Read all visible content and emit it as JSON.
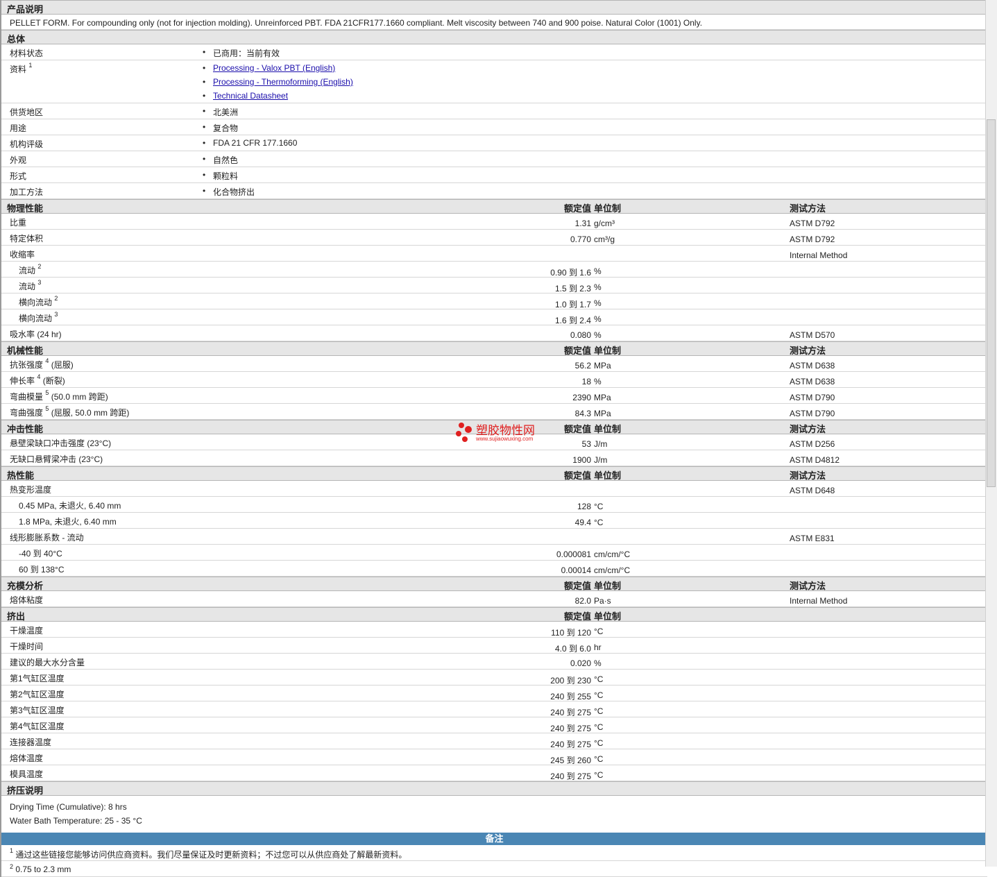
{
  "description": {
    "header": "产品说明",
    "text": "PELLET FORM. For compounding only (not for injection molding). Unreinforced PBT. FDA 21CFR177.1660 compliant. Melt viscosity between 740 and 900 poise. Natural Color (1001) Only."
  },
  "general": {
    "header": "总体",
    "status_label": "材料状态",
    "status_value": "已商用：当前有效",
    "docs_label": "资料",
    "docs_sup": "1",
    "docs": [
      "Processing - Valox PBT (English)",
      "Processing - Thermoforming (English)",
      "Technical Datasheet"
    ],
    "rows": [
      {
        "label": "供货地区",
        "value": "北美洲"
      },
      {
        "label": "用途",
        "value": "复合物"
      },
      {
        "label": "机构评级",
        "value": "FDA 21 CFR 177.1660"
      },
      {
        "label": "外观",
        "value": "自然色"
      },
      {
        "label": "形式",
        "value": "颗粒料"
      },
      {
        "label": "加工方法",
        "value": "化合物挤出"
      }
    ]
  },
  "cols": {
    "value": "额定值",
    "unit": "单位制",
    "method": "测试方法"
  },
  "physical": {
    "header": "物理性能",
    "rows": [
      {
        "label": "比重",
        "value": "1.31",
        "unit": "g/cm³",
        "method": "ASTM D792"
      },
      {
        "label": "特定体积",
        "value": "0.770",
        "unit": "cm³/g",
        "method": "ASTM D792"
      },
      {
        "label": "收缩率",
        "value": "",
        "unit": "",
        "method": "Internal Method"
      },
      {
        "label": "流动",
        "sup": "2",
        "indent": true,
        "value": "0.90 到  1.6",
        "unit": "%",
        "method": ""
      },
      {
        "label": "流动",
        "sup": "3",
        "indent": true,
        "value": "1.5 到  2.3",
        "unit": "%",
        "method": ""
      },
      {
        "label": "横向流动",
        "sup": "2",
        "indent": true,
        "value": "1.0 到  1.7",
        "unit": "%",
        "method": ""
      },
      {
        "label": "横向流动",
        "sup": "3",
        "indent": true,
        "value": "1.6 到  2.4",
        "unit": "%",
        "method": ""
      },
      {
        "label": "吸水率  (24 hr)",
        "value": "0.080",
        "unit": "%",
        "method": "ASTM D570"
      }
    ]
  },
  "mechanical": {
    "header": "机械性能",
    "rows": [
      {
        "label": "抗张强度",
        "sup": "4",
        "suffix": " (屈服)",
        "value": "56.2",
        "unit": "MPa",
        "method": "ASTM D638"
      },
      {
        "label": "伸长率",
        "sup": "4",
        "suffix": " (断裂)",
        "value": "18",
        "unit": "%",
        "method": "ASTM D638"
      },
      {
        "label": "弯曲模量",
        "sup": "5",
        "suffix": " (50.0 mm 跨距)",
        "value": "2390",
        "unit": "MPa",
        "method": "ASTM D790"
      },
      {
        "label": "弯曲强度",
        "sup": "5",
        "suffix": " (屈服, 50.0 mm 跨距)",
        "value": "84.3",
        "unit": "MPa",
        "method": "ASTM D790"
      }
    ]
  },
  "impact": {
    "header": "冲击性能",
    "rows": [
      {
        "label": "悬壁梁缺口冲击强度  (23°C)",
        "value": "53",
        "unit": "J/m",
        "method": "ASTM D256"
      },
      {
        "label": "无缺口悬臂梁冲击  (23°C)",
        "value": "1900",
        "unit": "J/m",
        "method": "ASTM D4812"
      }
    ]
  },
  "thermal": {
    "header": "热性能",
    "rows": [
      {
        "label": "热变形温度",
        "value": "",
        "unit": "",
        "method": "ASTM D648"
      },
      {
        "label": "0.45 MPa, 未退火, 6.40 mm",
        "indent": true,
        "value": "128",
        "unit": "°C",
        "method": ""
      },
      {
        "label": "1.8 MPa, 未退火, 6.40 mm",
        "indent": true,
        "value": "49.4",
        "unit": "°C",
        "method": ""
      },
      {
        "label": "线形膨胀系数  - 流动",
        "value": "",
        "unit": "",
        "method": "ASTM E831"
      },
      {
        "label": "-40 到  40°C",
        "indent": true,
        "value": "0.000081",
        "unit": "cm/cm/°C",
        "method": ""
      },
      {
        "label": "60 到  138°C",
        "indent": true,
        "value": "0.00014",
        "unit": "cm/cm/°C",
        "method": ""
      }
    ]
  },
  "filling": {
    "header": "充模分析",
    "rows": [
      {
        "label": "熔体粘度",
        "value": "82.0",
        "unit": "Pa·s",
        "method": "Internal Method"
      }
    ]
  },
  "extrusion": {
    "header": "挤出",
    "rows": [
      {
        "label": "干燥温度",
        "value": "110 到  120",
        "unit": "°C"
      },
      {
        "label": "干燥时间",
        "value": "4.0 到  6.0",
        "unit": "hr"
      },
      {
        "label": "建议的最大水分含量",
        "value": "0.020",
        "unit": "%"
      },
      {
        "label": "第1气缸区温度",
        "value": "200 到  230",
        "unit": "°C"
      },
      {
        "label": "第2气缸区温度",
        "value": "240 到  255",
        "unit": "°C"
      },
      {
        "label": "第3气缸区温度",
        "value": "240 到  275",
        "unit": "°C"
      },
      {
        "label": "第4气缸区温度",
        "value": "240 到  275",
        "unit": "°C"
      },
      {
        "label": "连接器温度",
        "value": "240 到  275",
        "unit": "°C"
      },
      {
        "label": "熔体温度",
        "value": "245 到  260",
        "unit": "°C"
      },
      {
        "label": "模具温度",
        "value": "240 到  275",
        "unit": "°C"
      }
    ]
  },
  "extrusion_notes": {
    "header": "挤压说明",
    "lines": [
      "Drying Time (Cumulative): 8 hrs",
      "Water Bath Temperature: 25 - 35 °C"
    ]
  },
  "notes": {
    "header": "备注",
    "items": [
      {
        "sup": "1",
        "text": "通过这些链接您能够访问供应商资料。我们尽量保证及时更新资料；不过您可以从供应商处了解最新资料。"
      },
      {
        "sup": "2",
        "text": "0.75 to 2.3 mm"
      }
    ]
  },
  "watermark": {
    "cn": "塑胶物性网",
    "en": "www.sujiaowuxing.com"
  }
}
